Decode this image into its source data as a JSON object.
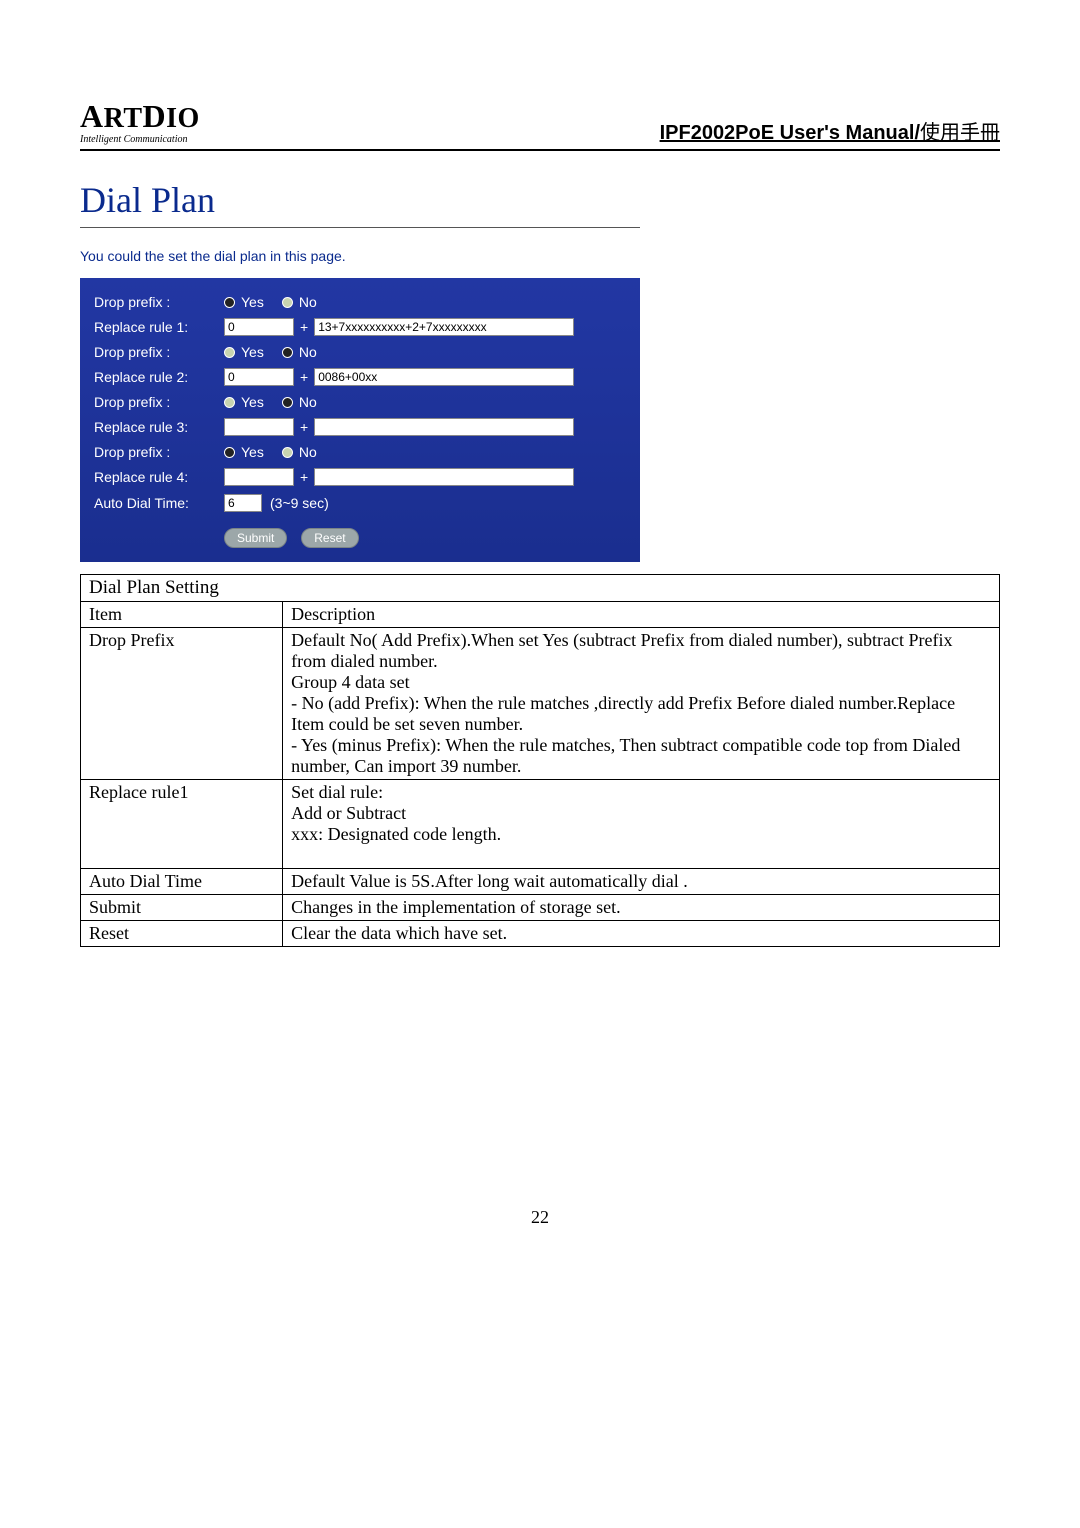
{
  "header": {
    "logo_main": "ARTDIO",
    "logo_sub": "Intelligent Communication",
    "manual_title": "IPF2002PoE User's Manual/",
    "manual_title_cjk": "使用手冊"
  },
  "dial_plan": {
    "heading": "Dial Plan",
    "subheading": "You could the set the dial plan in this page.",
    "rows": [
      {
        "label": "Drop prefix :",
        "yes": "Yes",
        "no": "No",
        "yes_sel": false,
        "no_sel": true
      },
      {
        "label": "Replace rule 1:",
        "prefix": "0",
        "plus": "+",
        "rule": "13+7xxxxxxxxxx+2+7xxxxxxxxx"
      },
      {
        "label": "Drop prefix :",
        "yes": "Yes",
        "no": "No",
        "yes_sel": true,
        "no_sel": false
      },
      {
        "label": "Replace rule 2:",
        "prefix": "0",
        "plus": "+",
        "rule": "0086+00xx"
      },
      {
        "label": "Drop prefix :",
        "yes": "Yes",
        "no": "No",
        "yes_sel": true,
        "no_sel": false
      },
      {
        "label": "Replace rule 3:",
        "prefix": "",
        "plus": "+",
        "rule": ""
      },
      {
        "label": "Drop prefix :",
        "yes": "Yes",
        "no": "No",
        "yes_sel": false,
        "no_sel": true
      },
      {
        "label": "Replace rule 4:",
        "prefix": "",
        "plus": "+",
        "rule": ""
      }
    ],
    "auto_dial_label": "Auto Dial Time:",
    "auto_dial_value": "6",
    "auto_dial_hint": "(3~9 sec)",
    "submit": "Submit",
    "reset": "Reset"
  },
  "settings_table": {
    "title": "Dial Plan Setting",
    "header_item": "Item",
    "header_desc": "Description",
    "rows": [
      {
        "item": "Drop Prefix",
        "desc": "Default No( Add Prefix).When set Yes (subtract Prefix from dialed number), subtract Prefix from dialed number.\nGroup 4 data set\n- No (add Prefix): When the rule matches ,directly add Prefix Before dialed number.Replace Item could be set seven number.\n- Yes (minus Prefix): When the rule matches, Then subtract compatible code top from Dialed number, Can import 39 number."
      },
      {
        "item": "Replace rule1",
        "desc": "Set dial rule:\nAdd or Subtract\nxxx: Designated code length.\n\n"
      },
      {
        "item": "Auto Dial Time",
        "desc": "Default Value is 5S.After long wait automatically dial ."
      },
      {
        "item": "Submit",
        "desc": "Changes in the implementation of storage set."
      },
      {
        "item": "Reset",
        "desc": "Clear the data which have set."
      }
    ]
  },
  "page_number": "22"
}
